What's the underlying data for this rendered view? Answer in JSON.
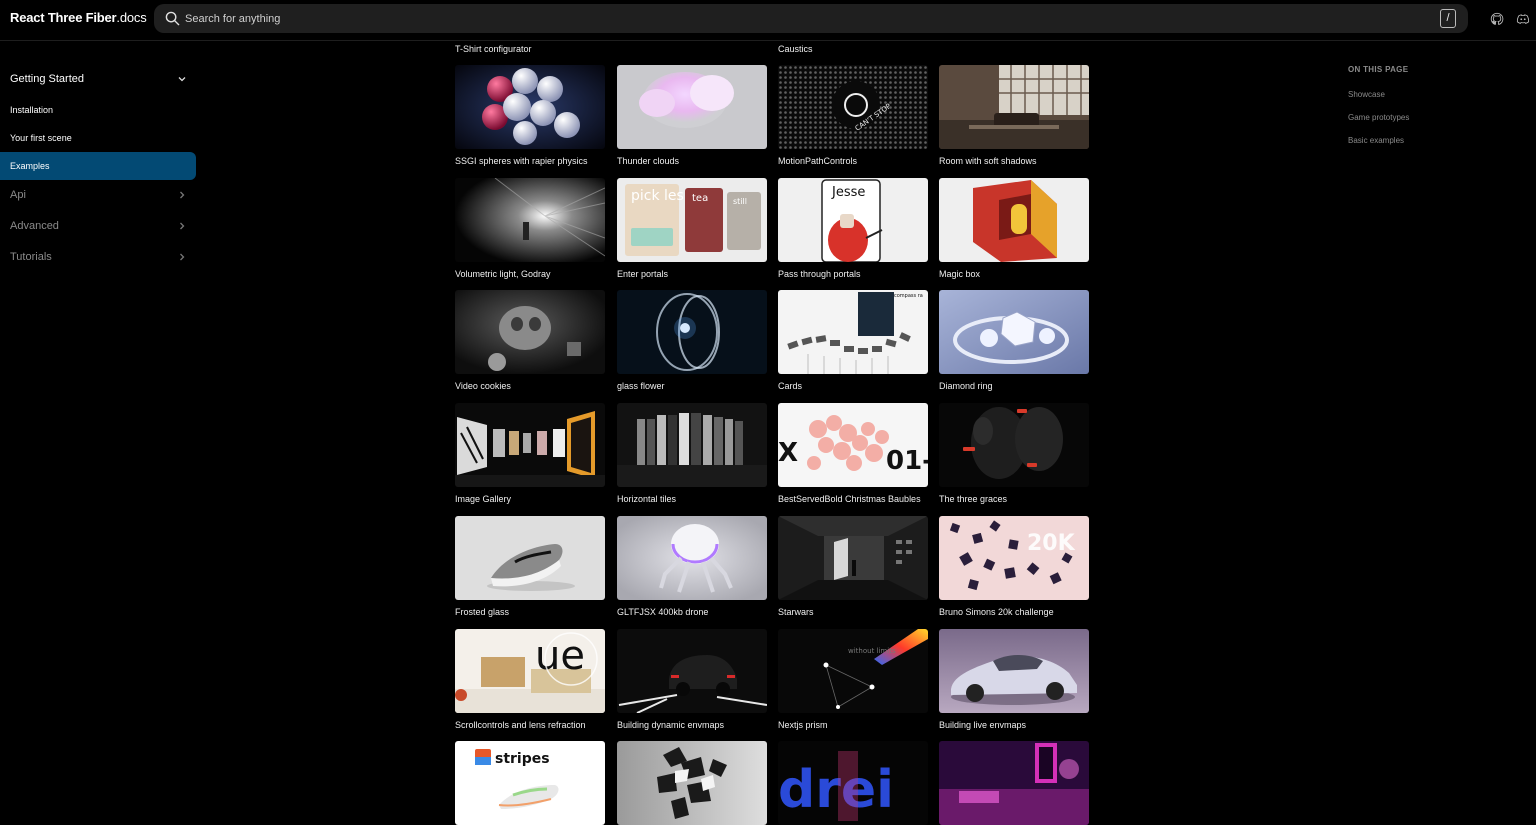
{
  "header": {
    "logo_strong": "React Three Fiber",
    "logo_light": ".docs",
    "search_placeholder": "Search for anything",
    "search_shortcut": "/"
  },
  "sidebar": {
    "sections": [
      {
        "label": "Getting Started",
        "expanded": true
      },
      {
        "label": "Api",
        "expanded": false
      },
      {
        "label": "Advanced",
        "expanded": false
      },
      {
        "label": "Tutorials",
        "expanded": false
      }
    ],
    "items": [
      {
        "label": "Installation",
        "active": false
      },
      {
        "label": "Your first scene",
        "active": false
      },
      {
        "label": "Examples",
        "active": true
      }
    ]
  },
  "gallery": {
    "top_labels": [
      "T-Shirt configurator",
      "Caustics"
    ],
    "cards": [
      "SSGI spheres with rapier physics",
      "Thunder clouds",
      "MotionPathControls",
      "Room with soft shadows",
      "Volumetric light, Godray",
      "Enter portals",
      "Pass through portals",
      "Magic box",
      "Video cookies",
      "glass flower",
      "Cards",
      "Diamond ring",
      "Image Gallery",
      "Horizontal tiles",
      "BestServedBold Christmas Baubles",
      "The three graces",
      "Frosted glass",
      "GLTFJSX 400kb drone",
      "Starwars",
      "Bruno Simons 20k challenge",
      "Scrollcontrols and lens refraction",
      "Building dynamic envmaps",
      "Nextjs prism",
      "Building live envmaps"
    ],
    "thumb_text": {
      "motion": "CAN'T STOP",
      "portals1": "pick les",
      "portals2": "tea",
      "portals3": "still",
      "portals4": "Jesse",
      "cards": "compass ra",
      "baubles": "01-",
      "baubles_x": "X",
      "bruno": "20K",
      "lens": "ue",
      "prism": "without limits",
      "stripes": "stripes",
      "drei": "drei"
    }
  },
  "toc": {
    "title": "ON THIS PAGE",
    "links": [
      "Showcase",
      "Game prototypes",
      "Basic examples"
    ]
  }
}
